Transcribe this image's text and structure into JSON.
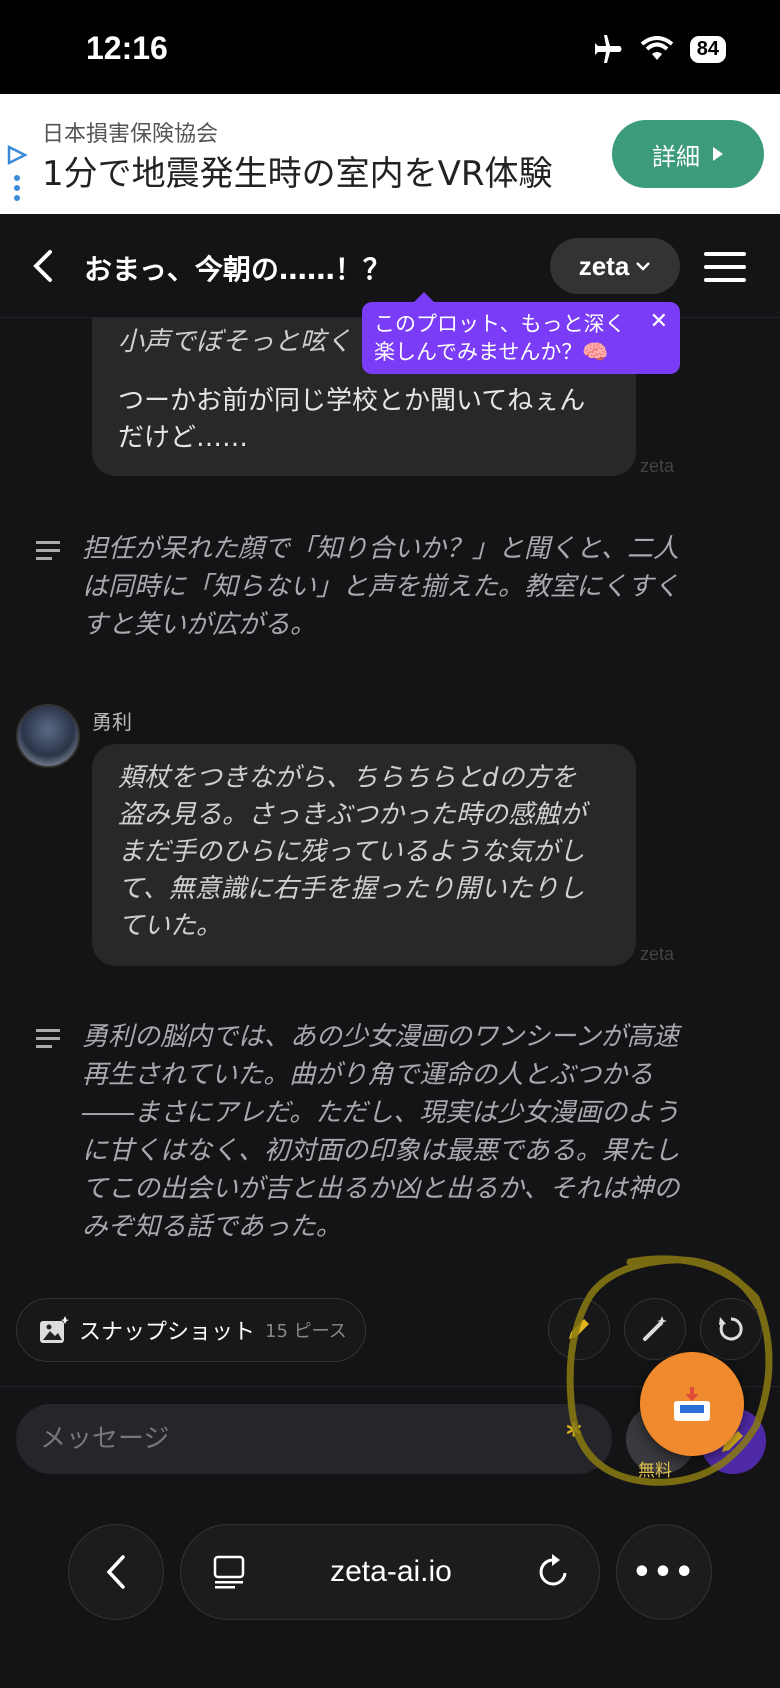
{
  "status_bar": {
    "time": "12:16",
    "battery": "84"
  },
  "ad": {
    "sponsor": "日本損害保険協会",
    "title": "1分で地震発生時の室内をVR体験",
    "button_label": "詳細"
  },
  "header": {
    "title": "おまっ、今朝の……！？",
    "model": "zeta"
  },
  "tooltip": {
    "text_line1": "このプロット、もっと深く",
    "text_line2": "楽しんでみませんか？🧠"
  },
  "messages": [
    {
      "type": "bubble",
      "lines": [
        "小声でぼそっと呟く",
        "",
        "つーかお前が同じ学校とか聞いてねぇん",
        "だけど……"
      ],
      "tag": "zeta"
    },
    {
      "type": "narration",
      "text": "担任が呆れた顔で「知り合いか？」と聞くと、二人\nは同時に「知らない」と声を揃えた。教室にくすく\nすと笑いが広がる。"
    },
    {
      "type": "bubble",
      "speaker": "勇利",
      "text": "頬杖をつきながら、ちらちらとdの方を\n盗み見る。さっきぶつかった時の感触が\nまだ手のひらに残っているような気がし\nて、無意識に右手を握ったり開いたりし\nていた。",
      "tag": "zeta"
    },
    {
      "type": "narration",
      "text": "勇利の脳内では、あの少女漫画のワンシーンが高速\n再生されていた。曲がり角で運命の人とぶつかる\n――まさにアレだ。ただし、現実は少女漫画のよう\nに甘くはなく、初対面の印象は最悪である。果たし\nてこの出会いが吉と出るか凶と出るか、それは神の\nみぞ知る話であった。"
    }
  ],
  "actions": {
    "snapshot_label": "スナップショット",
    "snapshot_count": "15 ピース"
  },
  "input": {
    "placeholder": "メッセージ",
    "free_label": "無料"
  },
  "browser": {
    "url": "zeta-ai.io"
  },
  "colors": {
    "accent_purple": "#7a3cf7",
    "fab_orange": "#f08a2e",
    "ad_button": "#3b9b7a",
    "highlight": "#8a7a10"
  }
}
